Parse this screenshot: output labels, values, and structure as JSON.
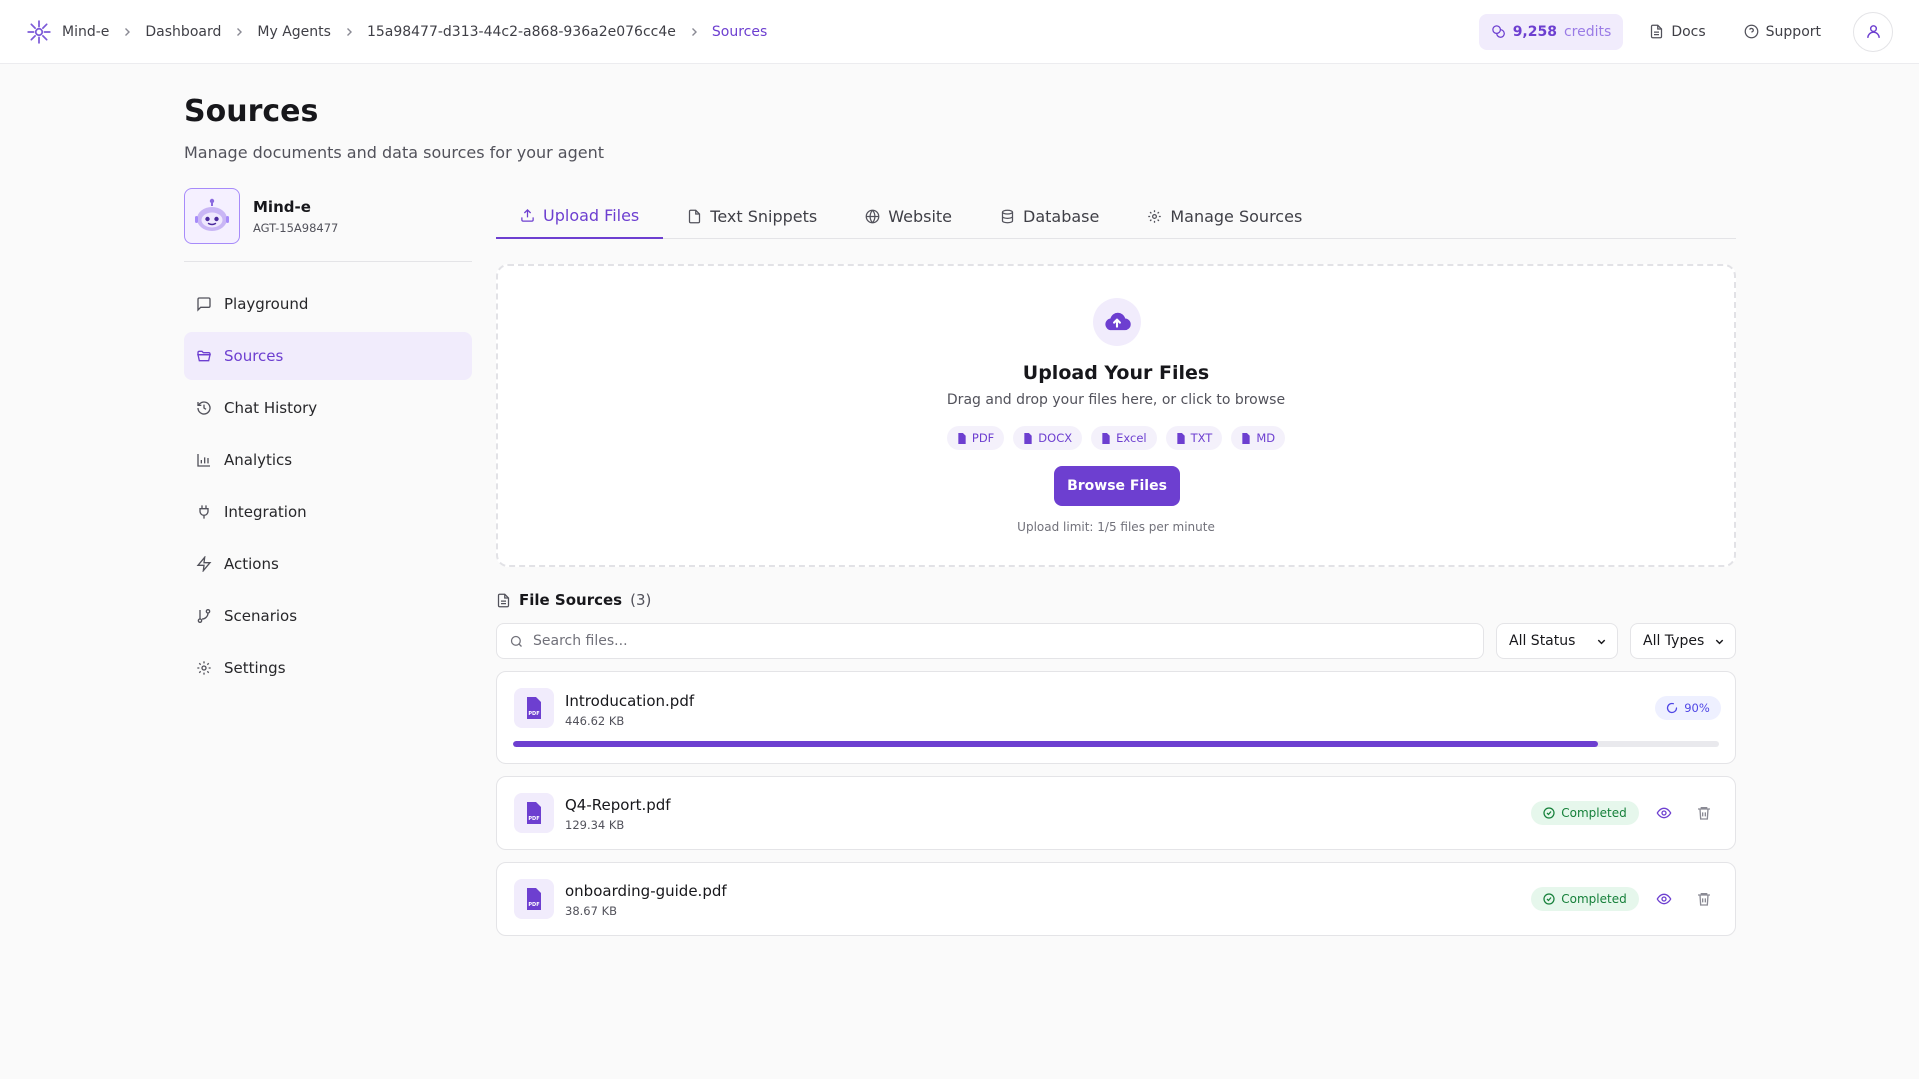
{
  "breadcrumb": {
    "items": [
      "Mind-e",
      "Dashboard",
      "My Agents",
      "15a98477-d313-44c2-a868-936a2e076cc4e",
      "Sources"
    ]
  },
  "topbar": {
    "credits_value": "9,258",
    "credits_label": "credits",
    "docs_label": "Docs",
    "support_label": "Support"
  },
  "page": {
    "title": "Sources",
    "subtitle": "Manage documents and data sources for your agent"
  },
  "agent": {
    "name": "Mind-e",
    "id": "AGT-15A98477"
  },
  "sidebar": {
    "items": [
      {
        "label": "Playground",
        "icon": "message-square-icon"
      },
      {
        "label": "Sources",
        "icon": "folder-icon",
        "active": true
      },
      {
        "label": "Chat History",
        "icon": "history-icon"
      },
      {
        "label": "Analytics",
        "icon": "bar-chart-icon"
      },
      {
        "label": "Integration",
        "icon": "plug-icon"
      },
      {
        "label": "Actions",
        "icon": "zap-icon"
      },
      {
        "label": "Scenarios",
        "icon": "git-branch-icon"
      },
      {
        "label": "Settings",
        "icon": "gear-icon"
      }
    ]
  },
  "tabs": [
    {
      "label": "Upload Files",
      "icon": "upload-icon",
      "active": true
    },
    {
      "label": "Text Snippets",
      "icon": "file-icon"
    },
    {
      "label": "Website",
      "icon": "globe-icon"
    },
    {
      "label": "Database",
      "icon": "database-icon"
    },
    {
      "label": "Manage Sources",
      "icon": "gear-icon"
    }
  ],
  "upload": {
    "title": "Upload Your Files",
    "subtitle": "Drag and drop your files here, or click to browse",
    "file_types": [
      "PDF",
      "DOCX",
      "Excel",
      "TXT",
      "MD"
    ],
    "button_label": "Browse Files",
    "limit_text": "Upload limit: 1/5 files per minute"
  },
  "file_sources": {
    "title": "File Sources",
    "count": "(3)",
    "search_placeholder": "Search files...",
    "status_filter": "All Status",
    "type_filter": "All Types",
    "files": [
      {
        "name": "Introducation.pdf",
        "size": "446.62 KB",
        "state": "uploading",
        "progress_label": "90%",
        "progress": 0.9
      },
      {
        "name": "Q4-Report.pdf",
        "size": "129.34 KB",
        "state": "done",
        "status": "Completed"
      },
      {
        "name": "onboarding-guide.pdf",
        "size": "38.67 KB",
        "state": "done",
        "status": "Completed"
      }
    ]
  },
  "colors": {
    "accent": "#6d3fd0",
    "accent_soft": "#f1ecfc",
    "success": "#16803a",
    "success_soft": "#e6f7ec"
  }
}
